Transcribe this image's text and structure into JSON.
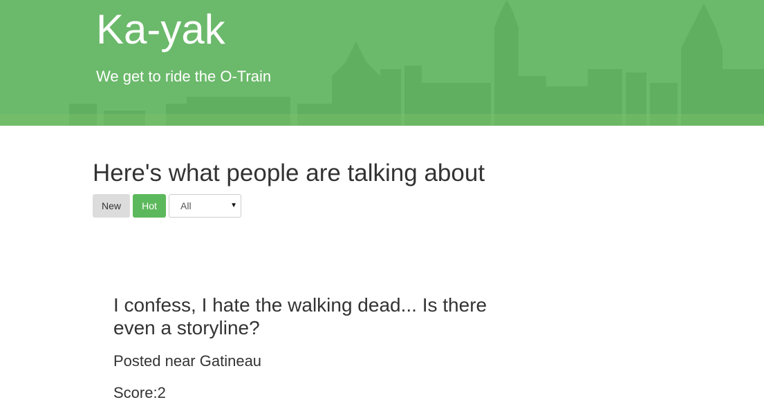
{
  "header": {
    "title": "Ka-yak",
    "subtitle": "We get to ride the O-Train",
    "colors": {
      "background": "#6bb96b",
      "text": "#ffffff"
    }
  },
  "main": {
    "heading": "Here's what people are talking about",
    "sort_buttons": [
      {
        "label": "New",
        "active": false
      },
      {
        "label": "Hot",
        "active": true
      }
    ],
    "filter": {
      "selected": "All"
    },
    "colors": {
      "active_button": "#5cb85c",
      "inactive_button": "#dcdcdc"
    }
  },
  "posts": [
    {
      "text": "I confess, I hate the walking dead... Is there even a storyline?",
      "location": "Posted near Gatineau",
      "score": "Score:2"
    }
  ]
}
